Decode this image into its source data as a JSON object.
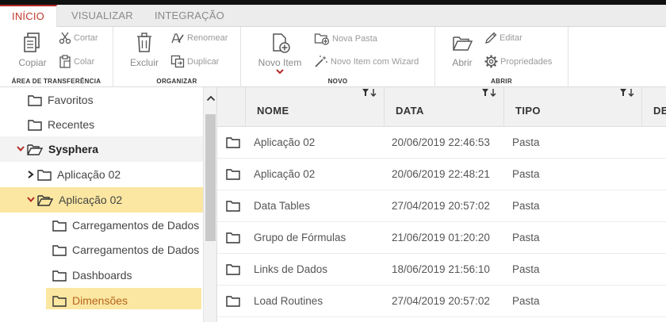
{
  "tabs": [
    {
      "label": "INÍCIO",
      "active": true
    },
    {
      "label": "VISUALIZAR",
      "active": false
    },
    {
      "label": "INTEGRAÇÃO",
      "active": false
    }
  ],
  "ribbon": {
    "clipboard": {
      "title": "ÁREA DE TRANSFERÊNCIA",
      "copy": "Copiar",
      "cut": "Cortar",
      "paste": "Colar"
    },
    "organize": {
      "title": "ORGANIZAR",
      "delete": "Excluir",
      "rename": "Renomear",
      "duplicate": "Duplicar"
    },
    "new": {
      "title": "NOVO",
      "new_item": "Novo Item",
      "new_folder": "Nova Pasta",
      "new_wizard": "Novo Item com Wizard"
    },
    "open": {
      "title": "ABRIR",
      "open": "Abrir",
      "edit": "Editar",
      "properties": "Propriedades"
    }
  },
  "tree": {
    "items": [
      {
        "label": "Favoritos"
      },
      {
        "label": "Recentes"
      },
      {
        "label": "Sysphera"
      },
      {
        "label": "Aplicação 02"
      },
      {
        "label": "Aplicação 02"
      },
      {
        "label": "Carregamentos de Dados no"
      },
      {
        "label": "Carregamentos de Dados no"
      },
      {
        "label": "Dashboards"
      },
      {
        "label": "Dimensões"
      }
    ]
  },
  "grid": {
    "columns": [
      "NOME",
      "DATA",
      "TIPO",
      "DE"
    ],
    "rows": [
      {
        "name": "Aplicação 02",
        "date": "20/06/2019 22:46:53",
        "type": "Pasta"
      },
      {
        "name": "Aplicação 02",
        "date": "20/06/2019 22:48:21",
        "type": "Pasta"
      },
      {
        "name": "Data Tables",
        "date": "27/04/2019 20:57:02",
        "type": "Pasta"
      },
      {
        "name": "Grupo de Fórmulas",
        "date": "21/06/2019 01:20:20",
        "type": "Pasta"
      },
      {
        "name": "Links de Dados",
        "date": "18/06/2019 21:56:10",
        "type": "Pasta"
      },
      {
        "name": "Load Routines",
        "date": "27/04/2019 20:57:02",
        "type": "Pasta"
      }
    ]
  },
  "colors": {
    "accent": "#b52a25",
    "highlight": "#fbe7a1",
    "header_bg": "#f1f1f1",
    "tab_bg": "#ececec"
  }
}
